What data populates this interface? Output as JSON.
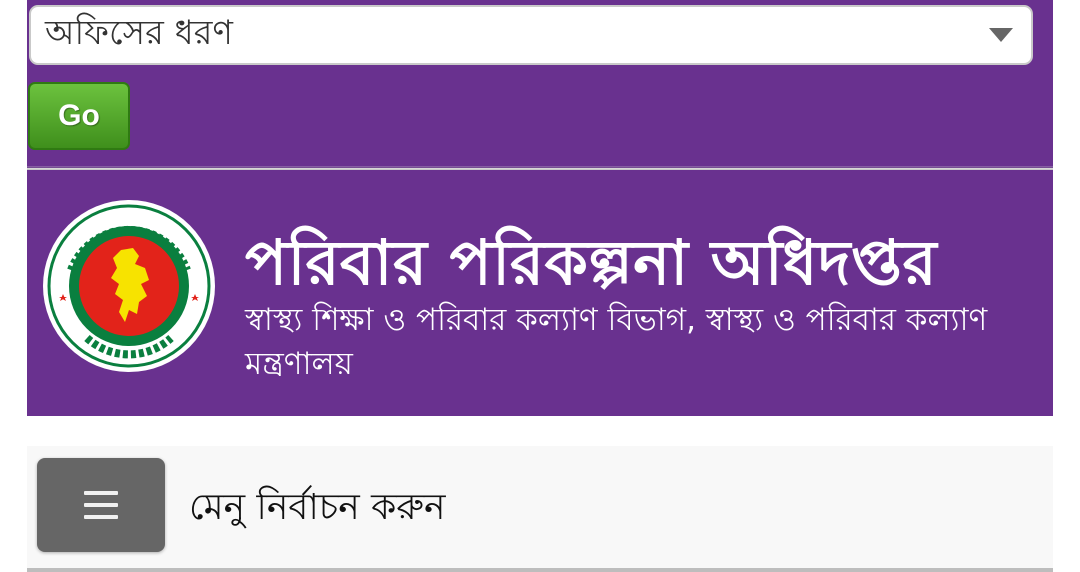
{
  "office_type_select": {
    "selected_value": "অফিসের ধরণ"
  },
  "go_button": {
    "label": "Go"
  },
  "header": {
    "title": "পরিবার পরিকল্পনা অধিদপ্তর",
    "subtitle": "স্বাস্থ্য শিক্ষা ও পরিবার কল্যাণ বিভাগ, স্বাস্থ্য ও পরিবার কল্যাণ মন্ত্রণালয়",
    "logo_icon": "bangladesh-government-seal-icon"
  },
  "menu": {
    "toggle_icon": "hamburger-menu-icon",
    "label": "মেনু নির্বাচন করুন"
  },
  "colors": {
    "header_purple": "#69318f",
    "go_green": "#4fa52a",
    "seal_red": "#e2231a",
    "seal_green": "#0a7f3f",
    "seal_yellow": "#f7e300"
  }
}
